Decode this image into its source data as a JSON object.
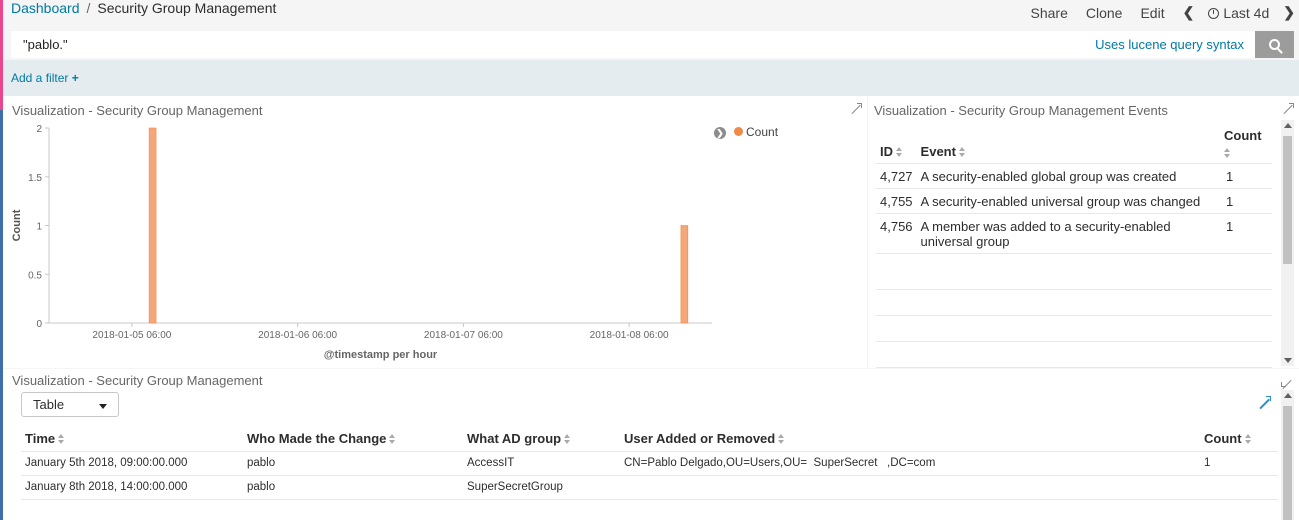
{
  "breadcrumb": {
    "root": "Dashboard",
    "separator": "/",
    "current": "Security Group Management"
  },
  "top_menu": {
    "share": "Share",
    "clone": "Clone",
    "edit": "Edit",
    "time_range": "Last 4d"
  },
  "query": {
    "value": "\"pablo.\"",
    "syntax_link": "Uses lucene query syntax"
  },
  "filter": {
    "add_label": "Add a filter",
    "add_icon": "+"
  },
  "colors": {
    "bar": "#f5a77a",
    "bar_stroke": "#ee8a4a",
    "legend_dot": "#ef8a4a",
    "link": "#0079a5",
    "accent_pink": "#e8488b"
  },
  "panels": {
    "histogram": {
      "title": "Visualization - Security Group Management"
    },
    "events": {
      "title": "Visualization - Security Group Management Events"
    },
    "table": {
      "title": "Visualization - Security Group Management"
    }
  },
  "chart_data": {
    "type": "bar",
    "xlabel": "@timestamp per hour",
    "ylabel": "Count",
    "ylim": [
      0,
      2
    ],
    "yticks": [
      "0",
      "0.5",
      "1",
      "1.5",
      "2"
    ],
    "xticks": [
      "2018-01-05 06:00",
      "2018-01-06 06:00",
      "2018-01-07 06:00",
      "2018-01-08 06:00"
    ],
    "x_range": [
      "2018-01-04 18:00",
      "2018-01-08 18:00"
    ],
    "legend": {
      "label": "Count",
      "position": "top-right"
    },
    "grid": false,
    "series": [
      {
        "name": "Count",
        "points": [
          {
            "x": "2018-01-05 09:00",
            "y": 2
          },
          {
            "x": "2018-01-08 14:00",
            "y": 1
          }
        ]
      }
    ]
  },
  "events_table": {
    "headers": [
      "ID",
      "Event",
      "Count"
    ],
    "rows": [
      {
        "id": "4,727",
        "event": "A security-enabled global group was created",
        "count": "1"
      },
      {
        "id": "4,755",
        "event": "A security-enabled universal group was changed",
        "count": "1"
      },
      {
        "id": "4,756",
        "event": "A member was added to a security-enabled universal group",
        "count": "1"
      }
    ]
  },
  "view_select": {
    "selected": "Table"
  },
  "changes_table": {
    "headers": [
      "Time",
      "Who Made the Change",
      "What AD group",
      "User Added or Removed",
      "Count"
    ],
    "rows": [
      {
        "time": "January 5th 2018, 09:00:00.000",
        "who": "pablo",
        "group": "AccessIT",
        "user": "CN=Pablo Delgado,OU=Users,OU=  SuperSecret   ,DC=com",
        "count": "1"
      },
      {
        "time": "January 8th 2018, 14:00:00.000",
        "who": "pablo",
        "group": "SuperSecretGroup",
        "user": "",
        "count": ""
      }
    ]
  }
}
